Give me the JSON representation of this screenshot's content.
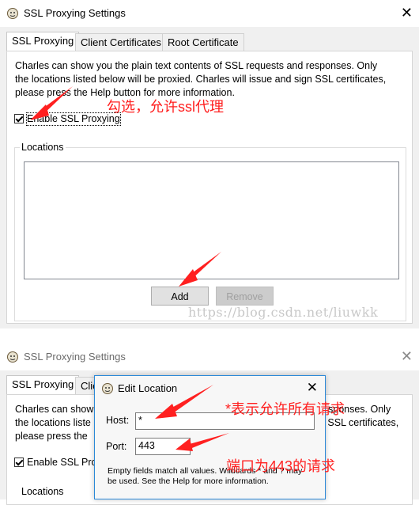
{
  "window1": {
    "title": "SSL Proxying Settings",
    "close_glyph": "✕",
    "icon": "charles-app-icon",
    "tabs": [
      "SSL Proxying",
      "Client Certificates",
      "Root Certificate"
    ],
    "description_lines": [
      "Charles can show you the plain text contents of SSL requests and responses. Only",
      "the locations listed below will be proxied. Charles will issue and sign SSL certificates,",
      "please press the Help button for more information."
    ],
    "enable_label": "Enable SSL Proxying",
    "enable_checked": true,
    "locations_title": "Locations",
    "add_button": "Add",
    "remove_button": "Remove",
    "annotation": "勾选，允许ssl代理"
  },
  "watermark": "https://blog.csdn.net/liuwkk",
  "window2": {
    "title": "SSL Proxying Settings",
    "close_glyph": "✕",
    "tabs": [
      "SSL Proxying",
      "Clie"
    ],
    "description_lines": [
      "Charles can show",
      "the locations liste",
      "please press the"
    ],
    "description_right": [
      "sponses. Only",
      "n SSL certificates,"
    ],
    "enable_label": "Enable SSL Pro",
    "locations_title": "Locations"
  },
  "dialog": {
    "title": "Edit Location",
    "close_glyph": "✕",
    "host_label": "Host:",
    "host_value": "*",
    "port_label": "Port:",
    "port_value": "443",
    "note_lines": [
      "Empty fields match all values. Wildcards * and ? may",
      "be used. See the Help for more information."
    ],
    "annotation_host": "*表示允许所有请求",
    "annotation_port": "端口为443的请求"
  },
  "colors": {
    "annotation": "#ff2020",
    "dialog_border": "#2b88d8"
  }
}
